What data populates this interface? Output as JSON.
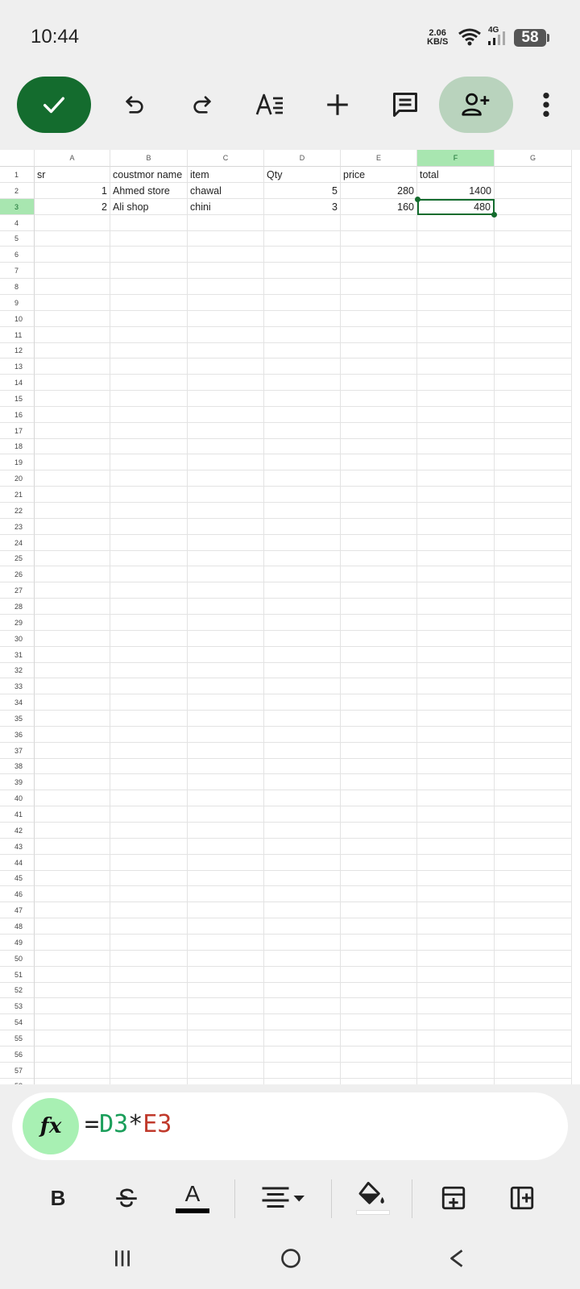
{
  "status_bar": {
    "time": "10:44",
    "net_speed_value": "2.06",
    "net_speed_unit": "KB/S",
    "network_type": "4G",
    "battery": "58"
  },
  "toolbar": {
    "icons": [
      "check-icon",
      "undo-icon",
      "redo-icon",
      "text-format-icon",
      "add-icon",
      "comment-icon",
      "add-person-icon",
      "more-vert-icon"
    ]
  },
  "sheet": {
    "columns": [
      "A",
      "B",
      "C",
      "D",
      "E",
      "F",
      "G"
    ],
    "selected_column": "F",
    "selected_row": 3,
    "rows": [
      [
        "sr",
        "coustmor name",
        "item",
        "Qty",
        "price",
        "total",
        ""
      ],
      [
        "1",
        "Ahmed store",
        "chawal",
        "5",
        "280",
        "1400",
        ""
      ],
      [
        "2",
        "Ali shop",
        "chini",
        "3",
        "160",
        "480",
        ""
      ]
    ],
    "visible_row_count": 58
  },
  "formula_bar": {
    "fx_label": "fx",
    "eq": "=",
    "ref1": "D3",
    "op": "*",
    "ref2": "E3",
    "ref1_color": "#1a9e5a",
    "ref2_color": "#c0392b"
  },
  "format_toolbar": {
    "bold_label": "B",
    "text_color_label": "A",
    "icons": [
      "bold-icon",
      "strikethrough-icon",
      "text-color-icon",
      "align-icon",
      "fill-color-icon",
      "insert-row-icon",
      "insert-column-icon"
    ]
  },
  "colors": {
    "accent": "#146c2e",
    "selection_header": "#a8e6b0"
  }
}
